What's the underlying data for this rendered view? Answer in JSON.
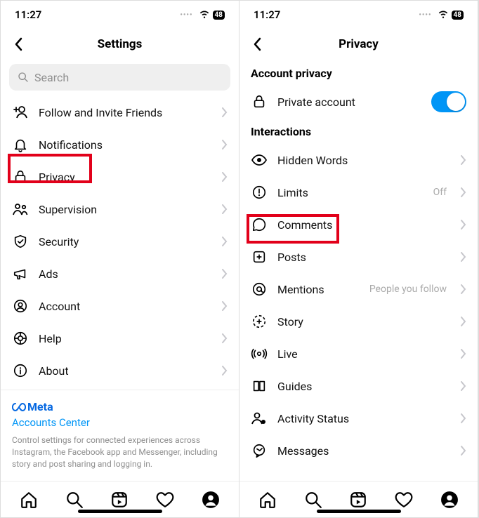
{
  "statusbar": {
    "time": "11:27",
    "battery": "48"
  },
  "left": {
    "title": "Settings",
    "search_placeholder": "Search",
    "rows": [
      {
        "label": "Follow and Invite Friends"
      },
      {
        "label": "Notifications"
      },
      {
        "label": "Privacy"
      },
      {
        "label": "Supervision"
      },
      {
        "label": "Security"
      },
      {
        "label": "Ads"
      },
      {
        "label": "Account"
      },
      {
        "label": "Help"
      },
      {
        "label": "About"
      }
    ],
    "footer": {
      "brand": "Meta",
      "accounts_center": "Accounts Center",
      "desc": "Control settings for connected experiences across Instagram, the Facebook app and Messenger, including story and post sharing and logging in."
    }
  },
  "right": {
    "title": "Privacy",
    "section_account": "Account privacy",
    "private_account": "Private account",
    "section_interactions": "Interactions",
    "rows": [
      {
        "label": "Hidden Words",
        "trail": ""
      },
      {
        "label": "Limits",
        "trail": "Off"
      },
      {
        "label": "Comments",
        "trail": ""
      },
      {
        "label": "Posts",
        "trail": ""
      },
      {
        "label": "Mentions",
        "trail": "People you follow"
      },
      {
        "label": "Story",
        "trail": ""
      },
      {
        "label": "Live",
        "trail": ""
      },
      {
        "label": "Guides",
        "trail": ""
      },
      {
        "label": "Activity Status",
        "trail": ""
      },
      {
        "label": "Messages",
        "trail": ""
      }
    ]
  }
}
